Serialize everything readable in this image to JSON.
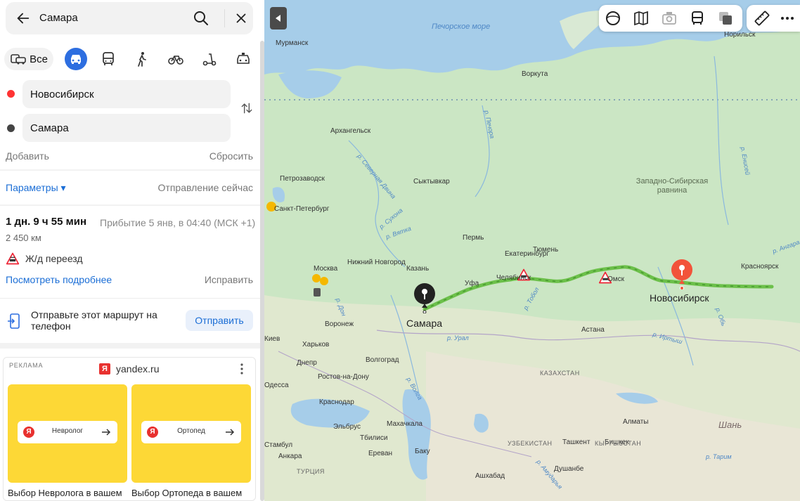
{
  "search": {
    "query": "Самара"
  },
  "modes": {
    "all_label": "Все"
  },
  "route_points": {
    "from": "Новосибирск",
    "to": "Самара"
  },
  "actions": {
    "add": "Добавить",
    "reset": "Сбросить"
  },
  "params": {
    "label": "Параметры ▾",
    "departure": "Отправление сейчас"
  },
  "route": {
    "duration": "1 дн. 9 ч 55 мин",
    "arrival": "Прибытие 5 янв, в 04:40 (МСК +1)",
    "distance": "2 450 км",
    "warning": "Ж/д переезд",
    "details_link": "Посмотреть подробнее",
    "fix_link": "Исправить"
  },
  "send": {
    "text": "Отправьте этот маршрут на телефон",
    "button": "Отправить"
  },
  "ad": {
    "label": "РЕКЛАМА",
    "domain": "yandex.ru",
    "logo": "Я",
    "cards": [
      {
        "pill": "Невролог",
        "caption": "Выбор Невролога в вашем"
      },
      {
        "pill": "Ортопед",
        "caption": "Выбор Ортопеда в вашем"
      }
    ]
  },
  "map": {
    "route_labels": {
      "start": "Самара",
      "end": "Новосибирск"
    },
    "seas": [
      {
        "name": "Печорское море"
      }
    ],
    "regions": [
      {
        "name": "Западно-Сибирская равнина"
      }
    ],
    "countries": [
      "КАЗАХСТАН",
      "УЗБЕКИСТАН",
      "КЫРГЫЗСТАН",
      "ТУРЦИЯ"
    ],
    "cities": [
      "Мурманск",
      "Норильск",
      "Воркута",
      "Архангельск",
      "Петрозаводск",
      "Сыктывкар",
      "Санкт-Петербург",
      "Пермь",
      "Екатеринбург",
      "Тюмень",
      "Нижний Новгород",
      "Москва",
      "Казань",
      "Уфа",
      "Челябинск",
      "Омск",
      "Красноярск",
      "Воронеж",
      "Астана",
      "Киев",
      "Харьков",
      "Днепр",
      "Волгоград",
      "Ростов-на-Дону",
      "Одесса",
      "Краснодар",
      "Эльбрус",
      "Махачкала",
      "Тбилиси",
      "Алматы",
      "Ташкент",
      "Бишкек",
      "Ереван",
      "Баку",
      "Анкара",
      "Душанбе",
      "Ашхабад",
      "Шань",
      "Стамбул"
    ],
    "rivers": [
      "р. Печора",
      "р. Северная Двина",
      "р. Сухона",
      "р. Вятка",
      "р. Дон",
      "р. Волга",
      "р. Урал",
      "р. Тобол",
      "р. Иртыш",
      "р. Обь",
      "р. Енисей",
      "р. Ангара",
      "р. Тарим",
      "р. Амударья"
    ]
  }
}
